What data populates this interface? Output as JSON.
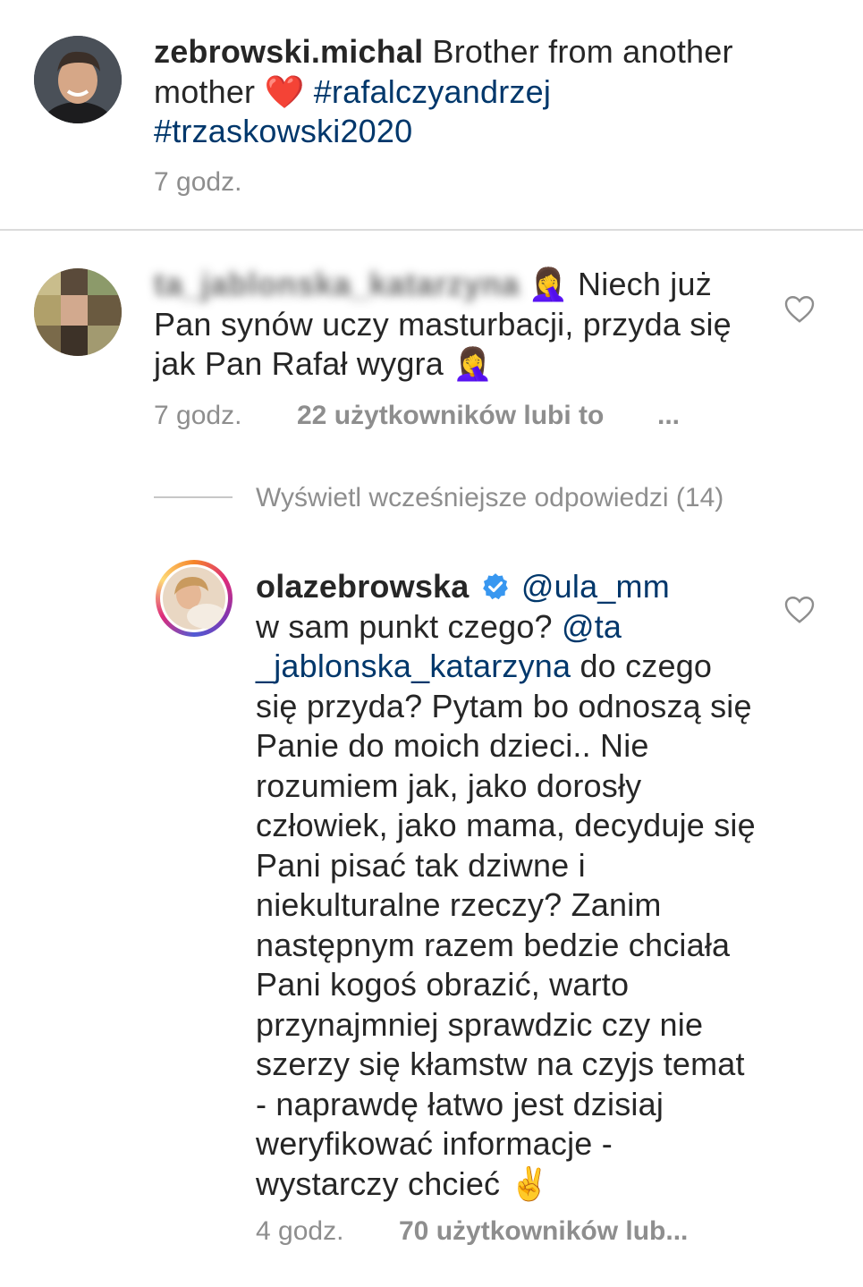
{
  "post": {
    "username": "zebrowski.michal",
    "caption_part1": "Brother from another mother",
    "heart_emoji": "❤️",
    "hashtag1": "#rafalczyandrzej",
    "hashtag2": "#trzaskowski2020",
    "time": "7 godz."
  },
  "comment1": {
    "username": "ta_jablonska_katarzyna",
    "emoji": "🤦‍♀️",
    "text_start": "Niech już Pan synów uczy masturbacji,  przyda się jak Pan Rafał wygra",
    "emoji_end": "🤦‍♀️",
    "time": "7 godz.",
    "likes": "22 użytkowników lubi to",
    "more": "..."
  },
  "replies": {
    "view_more": "Wyświetl wcześniejsze odpowiedzi (14)"
  },
  "reply1": {
    "username": "olazebrowska",
    "mention1": "@ula_mm",
    "text_a": "w sam punkt czego?",
    "mention2": "@ta _jablonska_katarzyna",
    "text_b": "do czego się przyda? Pytam bo odnoszą się Panie do moich dzieci.. Nie rozumiem jak, jako dorosły człowiek, jako mama, decyduje się Pani pisać tak dziwne i niekulturalne rzeczy? Zanim następnym razem bedzie chciała Pani kogoś obrazić, warto przynajmniej sprawdzic czy nie szerzy się kłamstw na czyjs temat - naprawdę łatwo jest dzisiaj weryfikować informacje - wystarczy chcieć",
    "emoji_end": "✌️",
    "time": "4 godz.",
    "likes": "70 użytkowników lub..."
  },
  "colors": {
    "text": "#262626",
    "secondary": "#8e8e8e",
    "link": "#00376b",
    "verified": "#3897f0",
    "divider": "#dbdbdb"
  }
}
